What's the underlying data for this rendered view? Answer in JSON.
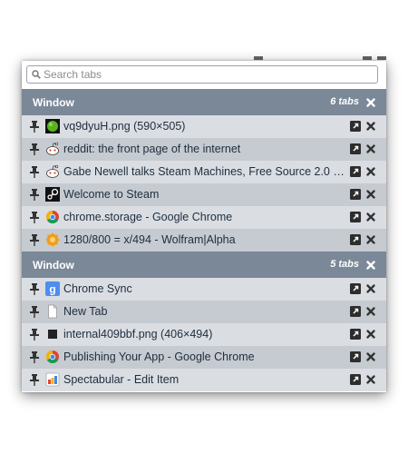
{
  "search": {
    "placeholder": "Search tabs",
    "value": ""
  },
  "windows": [
    {
      "label": "Window",
      "count": "6 tabs",
      "tabs": [
        {
          "title": "vq9dyuH.png (590×505)",
          "favicon": "green-dot-icon"
        },
        {
          "title": "reddit: the front page of the internet",
          "favicon": "reddit-icon"
        },
        {
          "title": "Gabe Newell talks Steam Machines, Free Source 2.0 En...",
          "favicon": "reddit-icon"
        },
        {
          "title": "Welcome to Steam",
          "favicon": "steam-icon"
        },
        {
          "title": "chrome.storage - Google Chrome",
          "favicon": "chrome-icon"
        },
        {
          "title": "1280/800 = x/494 - Wolfram|Alpha",
          "favicon": "wolfram-icon"
        }
      ]
    },
    {
      "label": "Window",
      "count": "5 tabs",
      "tabs": [
        {
          "title": "Chrome Sync",
          "favicon": "google-icon"
        },
        {
          "title": "New Tab",
          "favicon": "blank-page-icon"
        },
        {
          "title": "internal409bbf.png (406×494)",
          "favicon": "black-square-icon"
        },
        {
          "title": "Publishing Your App - Google Chrome",
          "favicon": "chrome-icon"
        },
        {
          "title": "Spectabular - Edit Item",
          "favicon": "spectabular-icon"
        }
      ]
    }
  ],
  "colors": {
    "header": "#7a8898",
    "row_odd": "#dadee3",
    "row_even": "#c6cbd1",
    "text": "#1f2d3d"
  }
}
